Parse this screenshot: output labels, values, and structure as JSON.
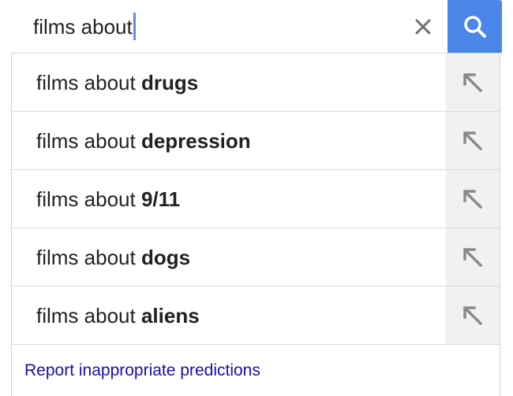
{
  "search": {
    "query": "films about",
    "placeholder": ""
  },
  "icons": {
    "clear": "close-icon",
    "search": "search-icon",
    "fill": "arrow-up-left-icon"
  },
  "colors": {
    "search_button": "#4a86e8",
    "caret": "#5e8ee6",
    "link": "#1a0dab",
    "fill_button_bg": "#f1f1f1"
  },
  "suggestions": [
    {
      "prefix": "films about ",
      "completion": "drugs"
    },
    {
      "prefix": "films about ",
      "completion": "depression"
    },
    {
      "prefix": "films about ",
      "completion": "9/11"
    },
    {
      "prefix": "films about ",
      "completion": "dogs"
    },
    {
      "prefix": "films about ",
      "completion": "aliens"
    }
  ],
  "footer": {
    "report_label": "Report inappropriate predictions"
  }
}
